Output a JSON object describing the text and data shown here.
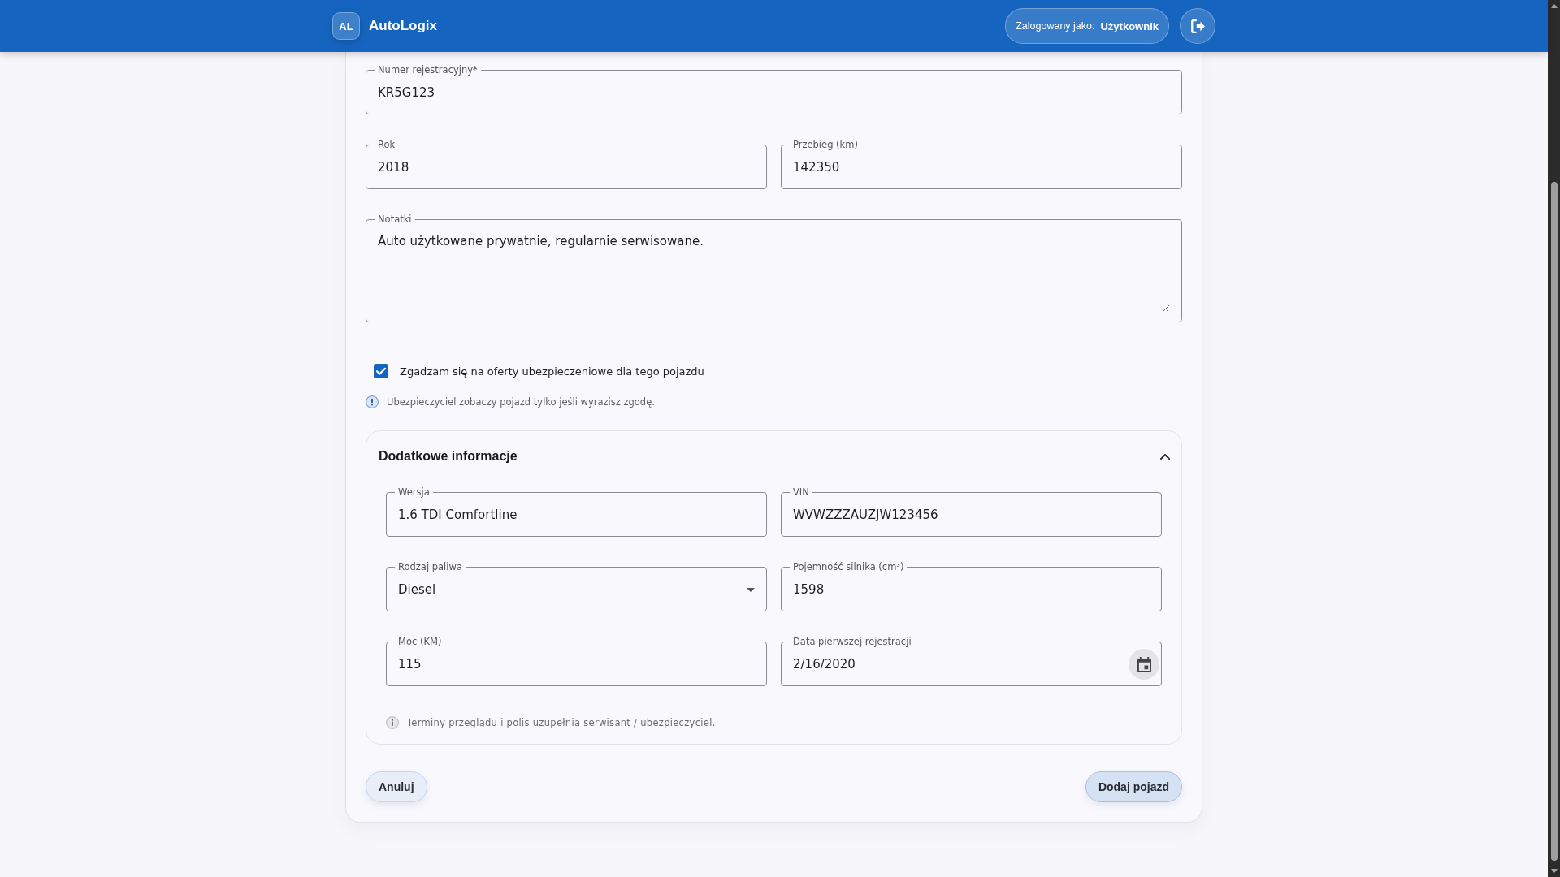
{
  "header": {
    "logo": "AL",
    "title": "AutoLogix",
    "user_label": "Zalogowany jako:",
    "user_name": "Użytkownik"
  },
  "form": {
    "rows": [
      [
        {
          "kind": "text",
          "label": "Numer rejestracyjny*",
          "value": "KR5G123"
        }
      ],
      [
        {
          "kind": "text",
          "label": "Rok",
          "value": "2018"
        },
        {
          "kind": "text",
          "label": "Przebieg (km)",
          "value": "142350"
        }
      ],
      [
        {
          "kind": "textarea",
          "label": "Notatki",
          "value": "Auto użytkowane prywatnie, regularnie serwisowane."
        }
      ]
    ],
    "consent": {
      "label": "Zgadzam się na oferty ubezpieczeniowe dla tego pojazdu",
      "checked": true
    },
    "consent_note": "Ubezpieczyciel zobaczy pojazd tylko jeśli wyrazisz zgodę.",
    "details": {
      "title": "Dodatkowe informacje",
      "expanded": true,
      "rows": [
        [
          {
            "kind": "text",
            "label": "Wersja",
            "value": "1.6 TDI Comfortline"
          },
          {
            "kind": "text",
            "label": "VIN",
            "value": "WVWZZZAUZJW123456"
          }
        ],
        [
          {
            "kind": "select",
            "label": "Rodzaj paliwa",
            "value": "Diesel"
          },
          {
            "kind": "text",
            "label": "Pojemność silnika (cm³)",
            "value": "1598"
          }
        ],
        [
          {
            "kind": "text",
            "label": "Moc (KM)",
            "value": "115"
          },
          {
            "kind": "date",
            "label": "Data pierwszej rejestracji",
            "value": "2/16/2020"
          }
        ]
      ],
      "note": "Terminy przeglądu i polis uzupełnia serwisant / ubezpieczyciel."
    },
    "buttons": [
      {
        "label": "Anuluj",
        "kind": "secondary"
      },
      {
        "label": "Dodaj pojazd",
        "kind": "primary"
      }
    ]
  }
}
